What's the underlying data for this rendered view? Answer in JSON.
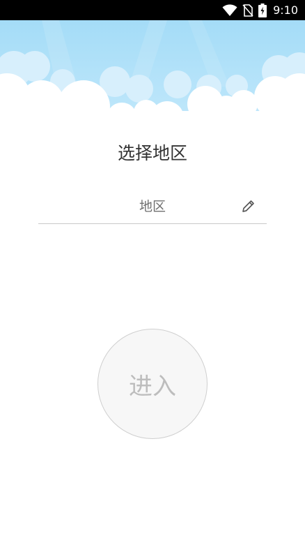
{
  "status_bar": {
    "time": "9:10",
    "icons": [
      "wifi-icon",
      "no-sim-icon",
      "battery-charging-icon"
    ]
  },
  "header": {
    "decoration": "sky-with-clouds",
    "sky_color": "#a7def8",
    "cloud_color": "#ffffff"
  },
  "page": {
    "title": "选择地区"
  },
  "region_field": {
    "placeholder": "地区",
    "value": "",
    "icon": "pencil-edit-icon"
  },
  "enter_button": {
    "label": "进入"
  }
}
